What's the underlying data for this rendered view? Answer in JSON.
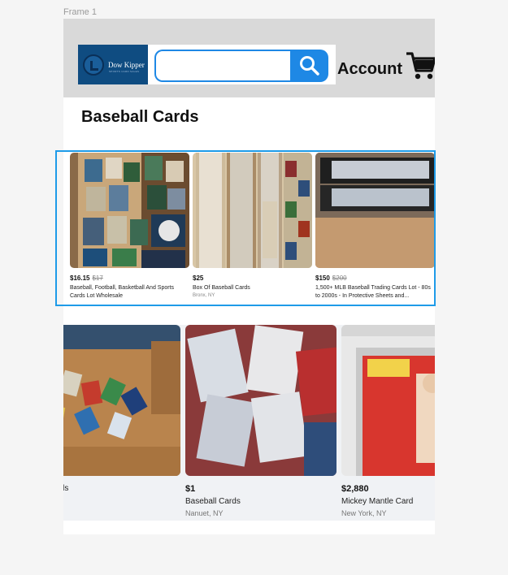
{
  "frame_label": "Frame 1",
  "header": {
    "logo_text": "Dow Kipper",
    "logo_tagline": "SPORTS CARD SALES",
    "search": {
      "value": "",
      "placeholder": ""
    },
    "account_label": "Account"
  },
  "section_title": "Baseball Cards",
  "featured": [
    {
      "price": "$16.15",
      "old_price": "$17",
      "title": "Baseball, Football, Basketball And Sports Cards Lot Wholesale",
      "location": ""
    },
    {
      "price": "$25",
      "old_price": "",
      "title": "Box Of Baseball Cards",
      "location": "Bronx, NY"
    },
    {
      "price": "$150",
      "old_price": "$200",
      "title": "1,500+ MLB Baseball Trading Cards Lot - 80s to 2000s - In Protective Sheets and...",
      "location": ""
    }
  ],
  "listings": [
    {
      "price": "",
      "title": "eball cards",
      "location": ""
    },
    {
      "price": "$1",
      "title": "Baseball Cards",
      "location": "Nanuet, NY"
    },
    {
      "price": "$2,880",
      "title": "Mickey Mantle Card",
      "location": "New York, NY"
    }
  ],
  "colors": {
    "accent": "#1e88e5",
    "header_bg": "#d9d9d9",
    "logo_bg": "#0f4c81",
    "selection": "#1e9be8"
  },
  "icons": {
    "search": "magnifier-icon",
    "cart": "shopping-cart-icon"
  }
}
